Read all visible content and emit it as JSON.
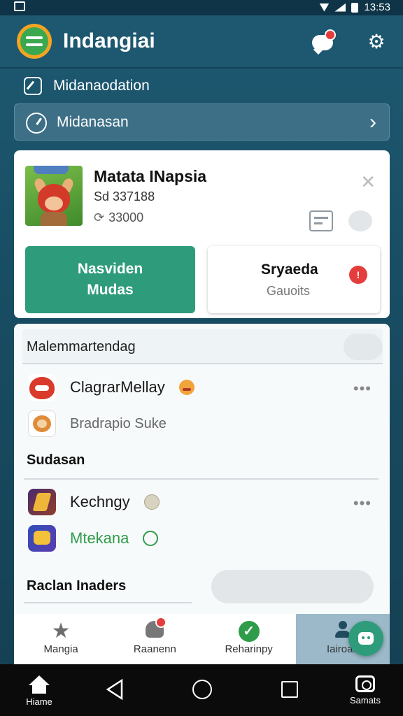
{
  "status_bar": {
    "time": "13:53"
  },
  "app": {
    "title": "Indangiai"
  },
  "menu": {
    "row1_label": "Midanaodation",
    "selector_label": "Midanasan"
  },
  "featured": {
    "title": "Matata INapsia",
    "line1": "Sd 337188",
    "line2": "33000",
    "primary_button": {
      "line1": "Nasviden",
      "line2": "Mudas"
    },
    "secondary_button": {
      "title": "Sryaeda",
      "subtitle": "Gauoits",
      "badge": "!"
    }
  },
  "list": {
    "header": "Malemmartendag",
    "items": [
      {
        "name": "ClagrarMellay",
        "icon": "red-monster-game-icon",
        "more": "..."
      },
      {
        "name": "Bradrapio Suke",
        "icon": "fox-game-icon"
      }
    ],
    "section2": "Sudasan",
    "items2": [
      {
        "name": "Kechngy",
        "icon": "sword-game-icon",
        "more": "..."
      },
      {
        "name": "Mtekana",
        "icon": "gold-game-icon"
      }
    ],
    "section3": "Raclan Inaders"
  },
  "tabs": [
    {
      "label": "Mangia",
      "icon": "star-icon"
    },
    {
      "label": "Raanenn",
      "icon": "people-icon"
    },
    {
      "label": "Reharinpy",
      "icon": "check-circle-icon"
    },
    {
      "label": "Iairoae",
      "icon": "person-icon"
    }
  ],
  "nav": {
    "home_label": "Hiame",
    "settings_label": "Samats"
  },
  "colors": {
    "accent": "#2e9c7a",
    "appbar": "#1d5870",
    "alert": "#e53c3c"
  }
}
